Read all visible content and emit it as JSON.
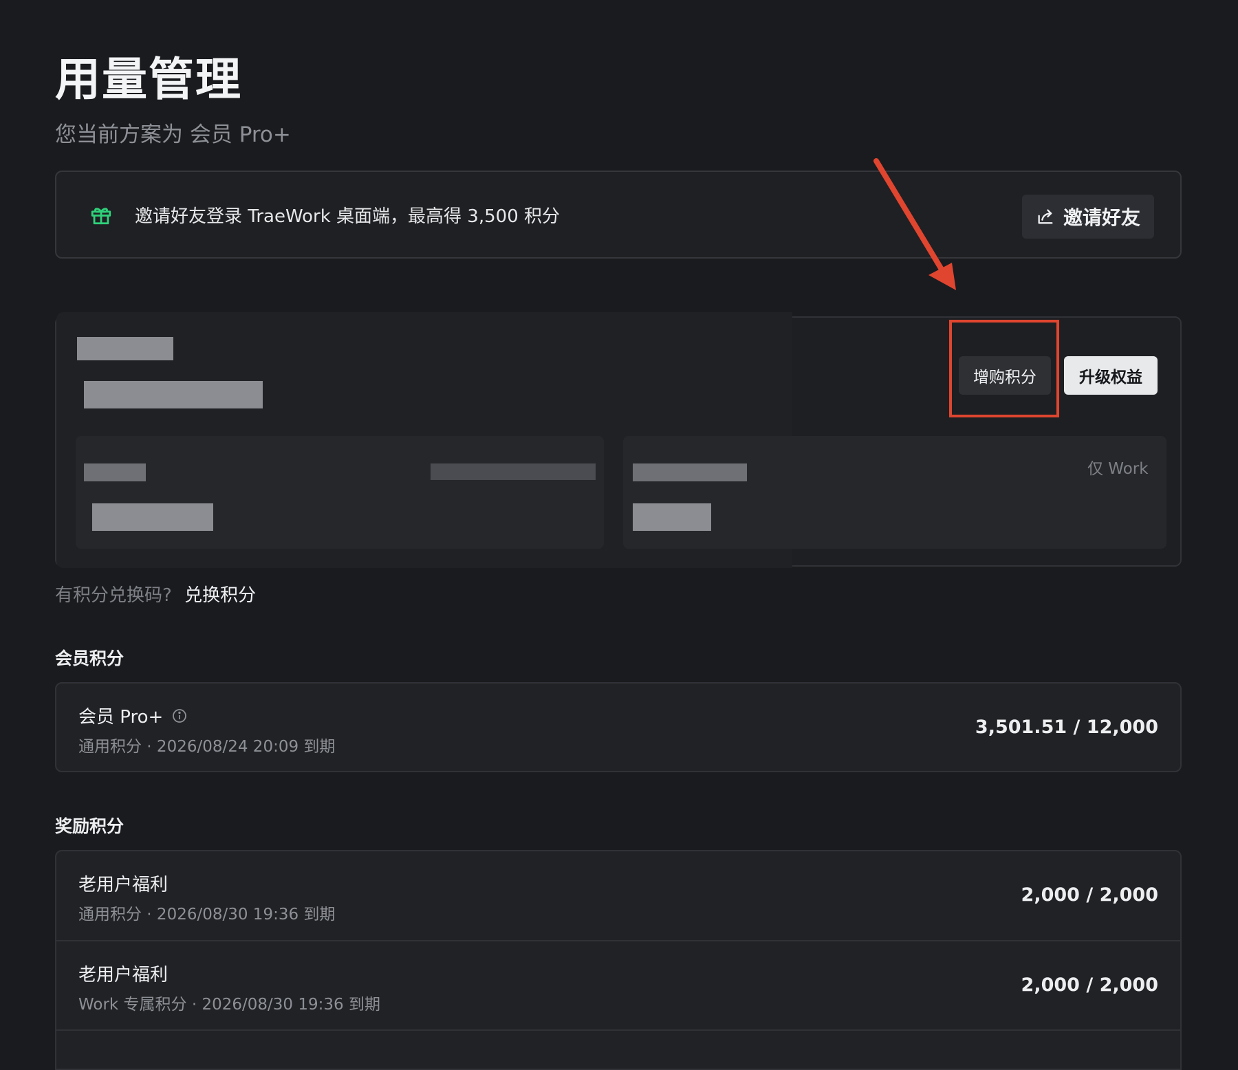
{
  "header": {
    "title": "用量管理",
    "plan_text": "您当前方案为 会员 Pro+"
  },
  "invite": {
    "icon": "gift-icon",
    "text": "邀请好友登录 TraeWork 桌面端，最高得 3,500 积分",
    "button_label": "邀请好友",
    "button_icon": "share-icon"
  },
  "credits_card": {
    "purchase_label": "增购积分",
    "upgrade_label": "升级权益",
    "work_only_label": "仅 Work"
  },
  "redeem": {
    "prompt": "有积分兑换码?",
    "link": "兑换积分"
  },
  "member_section": {
    "title": "会员积分",
    "items": [
      {
        "title": "会员 Pro+",
        "subtitle": "通用积分 · 2026/08/24 20:09 到期",
        "value": "3,501.51 / 12,000"
      }
    ]
  },
  "reward_section": {
    "title": "奖励积分",
    "items": [
      {
        "title": "老用户福利",
        "subtitle": "通用积分 · 2026/08/30 19:36 到期",
        "value": "2,000 / 2,000"
      },
      {
        "title": "老用户福利",
        "subtitle": "Work 专属积分 · 2026/08/30 19:36 到期",
        "value": "2,000 / 2,000"
      }
    ]
  },
  "colors": {
    "background": "#1a1b1e",
    "gift_icon": "#2fd27a",
    "annotation": "#e0452f",
    "upgrade_button": "#e8e9eb"
  }
}
